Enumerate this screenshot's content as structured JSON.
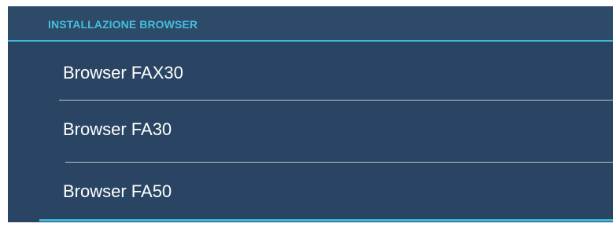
{
  "header": {
    "title": "INSTALLAZIONE BROWSER"
  },
  "menu": {
    "items": [
      {
        "label": "Browser FAX30"
      },
      {
        "label": "Browser FA30"
      },
      {
        "label": "Browser FA50"
      }
    ]
  },
  "colors": {
    "panel_background": "#294563",
    "header_accent": "#46bde0",
    "underline_accent": "#3fb8da",
    "item_text": "#ffffff",
    "divider": "#b8c4d0"
  }
}
